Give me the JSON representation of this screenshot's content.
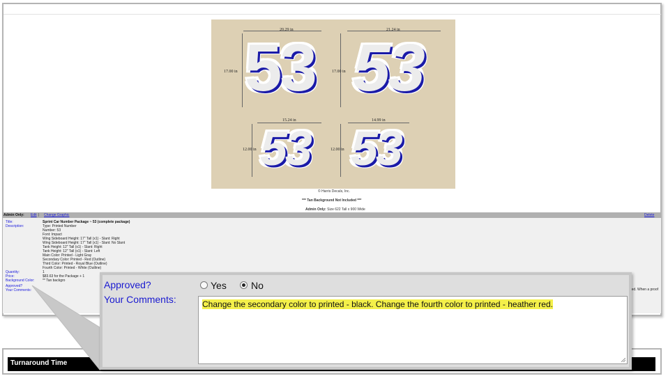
{
  "proof": {
    "dims": {
      "top_left_width": "20.29 in",
      "top_right_width": "21.24 in",
      "top_left_height": "17.00 in",
      "top_right_height": "17.00 in",
      "bottom_left_width": "15.24 in",
      "bottom_right_width": "14.99 in",
      "bottom_left_height": "12.00 in",
      "bottom_right_height": "12.00 in"
    },
    "number": "53",
    "copyright": "© Harris Decals, Inc.",
    "tan_note": "*** Tan Background Not Included ***",
    "admin_size_label": "Admin Only:",
    "admin_size_value": "Size 622 Tall x 900 Wide"
  },
  "adminbar": {
    "label": "Admin Only:",
    "edit": "Edit",
    "sep": "|",
    "change_graphic": "Change Graphic",
    "delete": "Delete"
  },
  "details": {
    "title_label": "Title:",
    "title_value": "Sprint Car Number Package ~ 53 (complete package)",
    "description_label": "Description:",
    "description_lines": [
      "Type: Printed Number",
      "Number: 53",
      "Font: Impact",
      "Wing Sideboard Height: 17\" Tall (x1) - Slant: Right",
      "Wing Sideboard Height: 17\" Tall (x1) - Slant: No Slant",
      "Tank Height: 12\" Tall (x1) - Slant: Right",
      "Tank Height: 12\" Tall (x1) - Slant: Left",
      "Main Color: Printed - Light Gray",
      "Secondary Color: Printed - Red (Outline)",
      "Third Color: Printed - Royal Blue (Outline)",
      "Fourth Color: Printed - White (Outline)"
    ],
    "quantity_label": "Quantity:",
    "quantity_value": "1",
    "price_label": "Price:",
    "price_value": "$83.63 for the Package + 1",
    "bg_label": "Background Color:",
    "bg_value": "** Tan backgro",
    "approved_label": "Approved?",
    "comments_label": "Your Comments:",
    "right_text": "rted. When a proof"
  },
  "callout": {
    "approved_label": "Approved?",
    "yes_label": "Yes",
    "no_label": "No",
    "comments_label": "Your Comments:",
    "comment_text": "Change the secondary color to printed - black. Change the fourth color to printed - heather red.",
    "selected": "No"
  },
  "turnaround": {
    "label": "Turnaround Time"
  },
  "colors": {
    "tan": "#ddd0b4",
    "number_fill": "#ececec",
    "number_red": "#e01010",
    "number_blue": "#1a1aa8",
    "link_blue": "#1a1ad0",
    "highlight": "#f4f04a"
  }
}
